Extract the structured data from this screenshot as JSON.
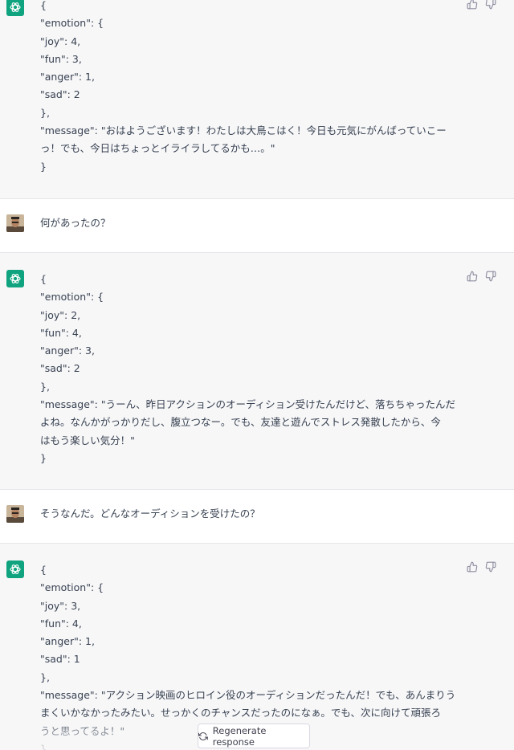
{
  "thread": [
    {
      "role": "assistant",
      "lines": [
        "{",
        "\"emotion\": {",
        "\"joy\": 4,",
        "\"fun\": 3,",
        "\"anger\": 1,",
        "\"sad\": 2",
        "},",
        "\"message\": \"おはようございます！わたしは大鳥こはく！今日も元気にがんばっていこー",
        "っ！でも、今日はちょっとイライラしてるかも…。\"",
        "}"
      ]
    },
    {
      "role": "user",
      "text": "何があったの？"
    },
    {
      "role": "assistant",
      "lines": [
        "{",
        "\"emotion\": {",
        "\"joy\": 2,",
        "\"fun\": 4,",
        "\"anger\": 3,",
        "\"sad\": 2",
        "},",
        "\"message\": \"うーん、昨日アクションのオーディション受けたんだけど、落ちちゃったんだ",
        "よね。なんかがっかりだし、腹立つなー。でも、友達と遊んでストレス発散したから、今",
        "はもう楽しい気分！\"",
        "}"
      ]
    },
    {
      "role": "user",
      "text": "そうなんだ。どんなオーディションを受けたの？"
    },
    {
      "role": "assistant",
      "lines": [
        "{",
        "\"emotion\": {",
        "\"joy\": 3,",
        "\"fun\": 4,",
        "\"anger\": 1,",
        "\"sad\": 1",
        "},",
        "\"message\": \"アクション映画のヒロイン役のオーディションだったんだ！でも、あんまりう",
        "まくいかなかったみたい。せっかくのチャンスだったのになぁ。でも、次に向けて頑張ろ",
        "うと思ってるよ！\"",
        "}"
      ]
    }
  ],
  "controls": {
    "regenerate_label": "Regenerate response"
  },
  "icons": {
    "assistant_avatar": "openai-logo-icon",
    "user_avatar": "user-photo-avatar",
    "thumbs_up": "thumbs-up-icon",
    "thumbs_down": "thumbs-down-icon",
    "regenerate": "refresh-icon"
  },
  "colors": {
    "assistant_bg": "#f7f7f8",
    "user_bg": "#ffffff",
    "accent": "#10a37f",
    "text": "#374151"
  }
}
